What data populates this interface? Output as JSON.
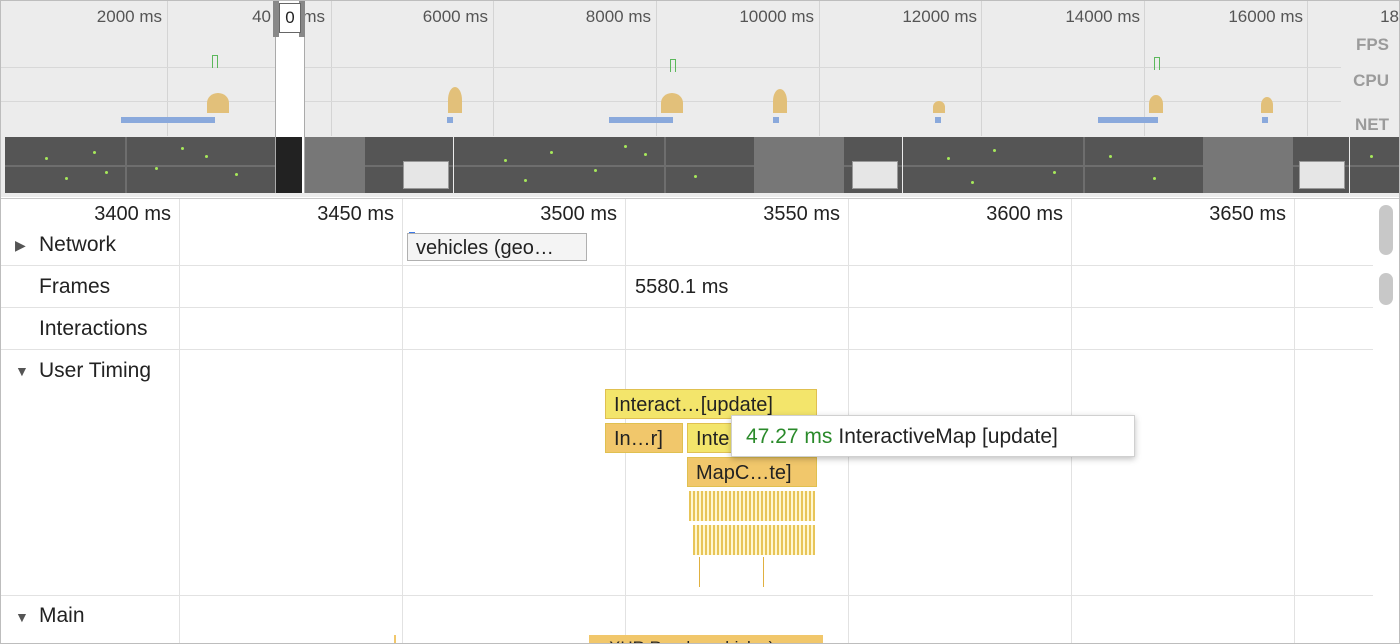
{
  "overview": {
    "ticks": [
      "2000 ms",
      "40",
      "ms",
      "6000 ms",
      "8000 ms",
      "10000 ms",
      "12000 ms",
      "14000 ms",
      "16000 ms",
      "18"
    ],
    "labels": {
      "fps": "FPS",
      "cpu": "CPU",
      "net": "NET"
    },
    "selection_value": "0"
  },
  "detail": {
    "ticks": [
      "3400 ms",
      "3450 ms",
      "3500 ms",
      "3550 ms",
      "3600 ms",
      "3650 ms"
    ],
    "tracks": {
      "network": "Network",
      "frames": "Frames",
      "interactions": "Interactions",
      "user_timing": "User Timing",
      "main": "Main"
    },
    "network_request": "vehicles (geo…",
    "frame_duration": "5580.1 ms",
    "user_timing_blocks": {
      "interactive_update": "Interact…[update]",
      "in_r": "In…r]",
      "inte": "Inte",
      "mapc": "MapC…te]"
    },
    "tooltip": {
      "duration": "47.27 ms",
      "name": "InteractiveMap [update]"
    },
    "main_block": "XHR Ready…ehicles)"
  },
  "colors": {
    "accent_green": "#2a8a2a",
    "user_timing": "#f1c76b",
    "user_timing_light": "#f3e56b",
    "net_bar": "#8aa9dc"
  }
}
